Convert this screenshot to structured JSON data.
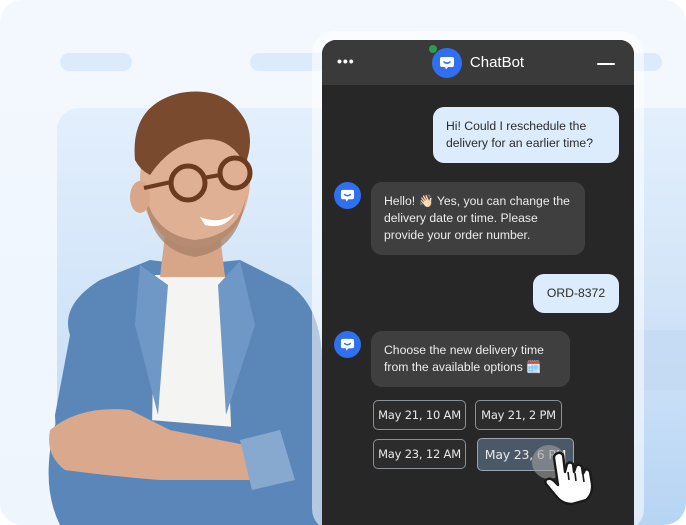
{
  "chat": {
    "title": "ChatBot",
    "menu_icon": "more-dots-icon",
    "minimize_icon": "minimize-icon",
    "status": "online",
    "colors": {
      "accent": "#2f6ff0",
      "online": "#2e9b4e",
      "header_bg": "#3a3a3a",
      "body_bg": "#272727",
      "user_bubble": "#dcecfc",
      "bot_bubble": "#3f3f3f",
      "selected_option": "#4b5868"
    },
    "messages": [
      {
        "sender": "user",
        "text": "Hi! Could I reschedule the delivery for an earlier time?"
      },
      {
        "sender": "bot",
        "text": "Hello! 👋🏻 Yes, you can change the delivery date or time. Please provide your order number."
      },
      {
        "sender": "user",
        "text": "ORD-8372"
      },
      {
        "sender": "bot",
        "text": "Choose the new delivery time from the available options 🗓️"
      }
    ],
    "options": [
      {
        "label": "May 21, 10 AM",
        "selected": false
      },
      {
        "label": "May 21, 2 PM",
        "selected": false
      },
      {
        "label": "May 23, 12 AM",
        "selected": false
      },
      {
        "label": "May 23, 6 PM",
        "selected": true
      }
    ],
    "cursor_icon": "pointer-hand-icon"
  },
  "illustration": {
    "subject": "smiling man with glasses and denim shirt, arms crossed"
  }
}
